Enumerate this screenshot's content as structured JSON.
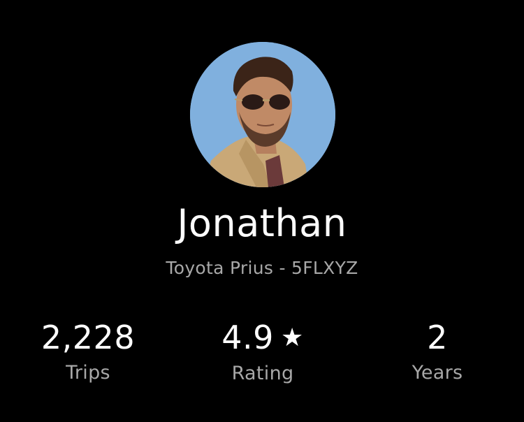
{
  "driver": {
    "name": "Jonathan",
    "vehicle": "Toyota Prius - 5FLXYZ"
  },
  "stats": {
    "trips": {
      "value": "2,228",
      "label": "Trips"
    },
    "rating": {
      "value": "4.9",
      "icon": "star-icon",
      "label": "Rating"
    },
    "years": {
      "value": "2",
      "label": "Years"
    }
  },
  "colors": {
    "background": "#000000",
    "primary_text": "#ffffff",
    "secondary_text": "#a8a8a8"
  }
}
